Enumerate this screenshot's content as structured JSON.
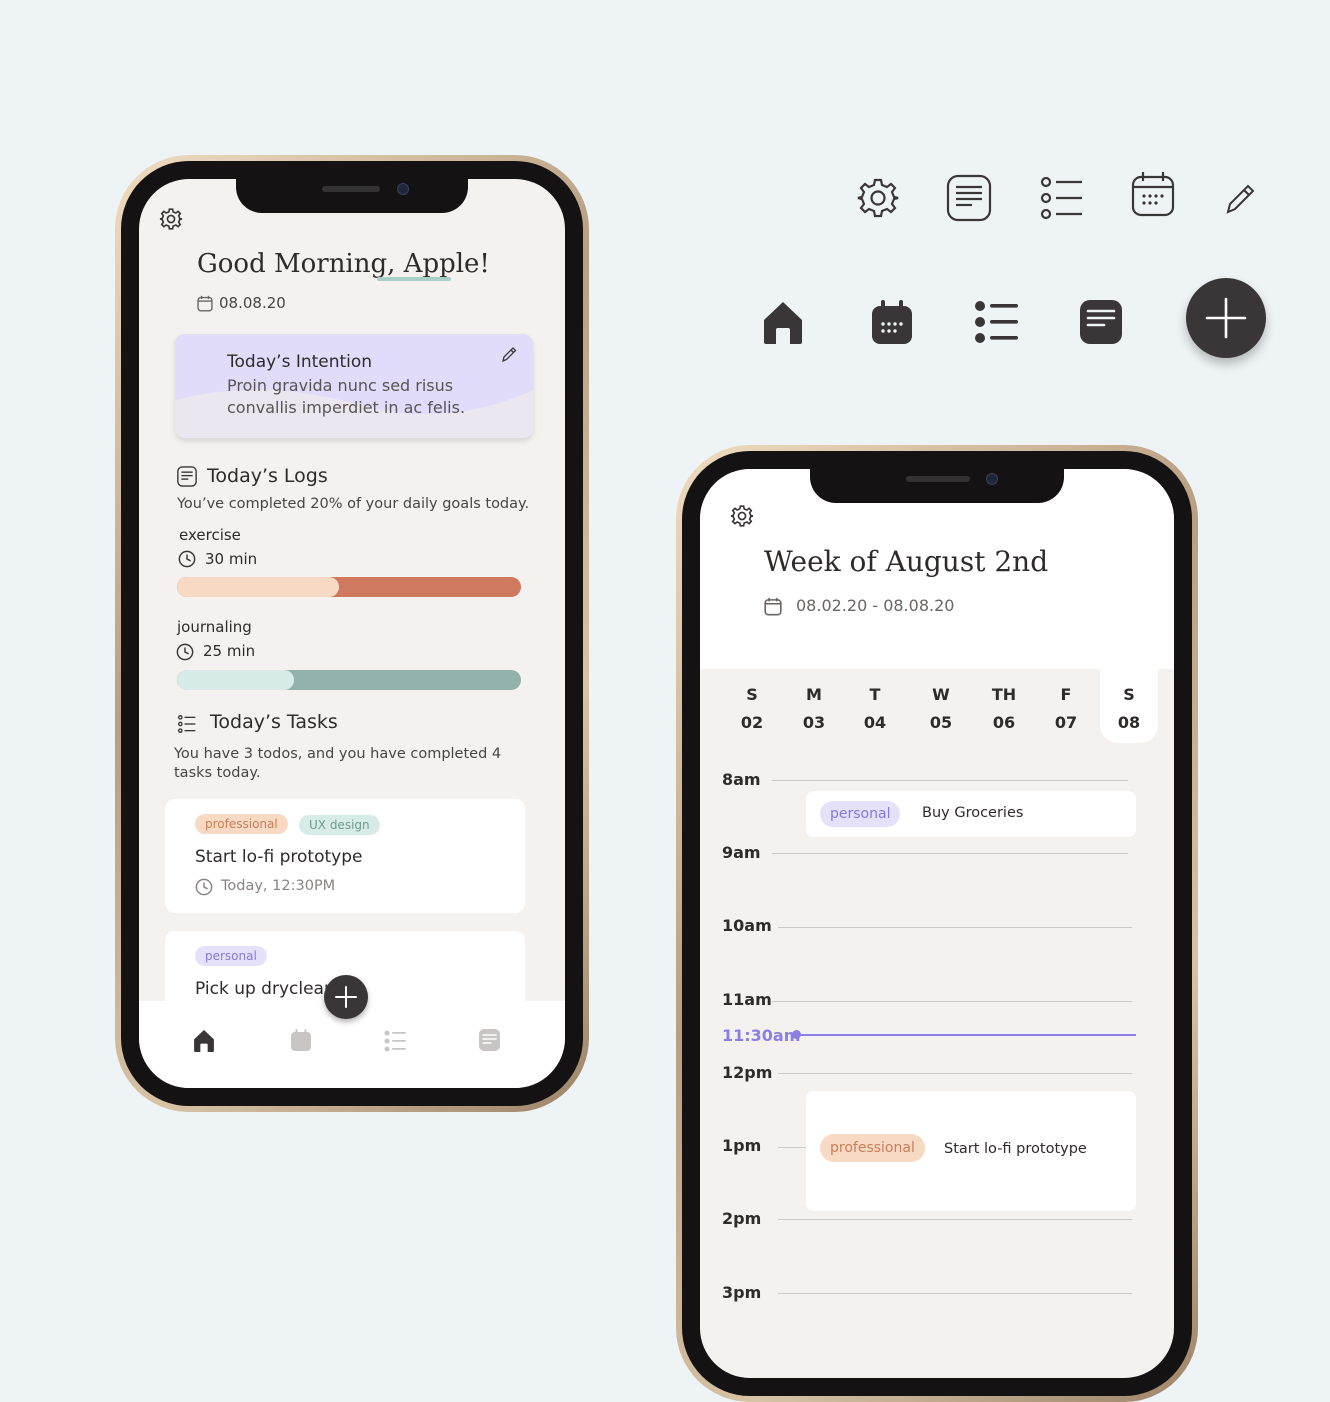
{
  "home": {
    "greeting": "Good Morning, Apple!",
    "date": "08.08.20",
    "intention": {
      "title": "Today’s Intention",
      "text": "Proin gravida nunc sed risus convallis imperdiet in ac felis."
    },
    "logs": {
      "title": "Today’s Logs",
      "subtitle": "You’ve completed 20% of your daily goals today.",
      "items": [
        {
          "name": "exercise",
          "duration": "30 min",
          "progress": 0.47
        },
        {
          "name": "journaling",
          "duration": "25 min",
          "progress": 0.34
        }
      ]
    },
    "tasks": {
      "title": "Today’s Tasks",
      "subtitle": "You have 3 todos, and you have completed 4 tasks today.",
      "items": [
        {
          "tags": [
            "professional",
            "UX design"
          ],
          "title": "Start lo-fi prototype",
          "time": "Today, 12:30PM"
        },
        {
          "tags": [
            "personal"
          ],
          "title": "Pick up dryclean"
        }
      ]
    }
  },
  "week": {
    "title": "Week of August 2nd",
    "range": "08.02.20 - 08.08.20",
    "days": [
      {
        "letter": "S",
        "date": "02"
      },
      {
        "letter": "M",
        "date": "03"
      },
      {
        "letter": "T",
        "date": "04"
      },
      {
        "letter": "W",
        "date": "05"
      },
      {
        "letter": "TH",
        "date": "06"
      },
      {
        "letter": "F",
        "date": "07"
      },
      {
        "letter": "S",
        "date": "08"
      }
    ],
    "hours": [
      "8am",
      "9am",
      "10am",
      "11am",
      "12pm",
      "1pm",
      "2pm",
      "3pm"
    ],
    "now": "11:30am",
    "events": [
      {
        "tag": "personal",
        "title": "Buy Groceries"
      },
      {
        "tag": "professional",
        "title": "Start lo-fi prototype"
      }
    ]
  },
  "icon_set": {
    "outline": [
      "gear-icon",
      "notes-icon",
      "list-icon",
      "calendar-icon",
      "pencil-icon"
    ],
    "filled": [
      "home-icon",
      "calendar-icon",
      "list-icon",
      "notes-icon",
      "plus-icon"
    ]
  },
  "colors": {
    "background": "#eef4f6",
    "screen": "#f5f1ef",
    "dark": "#3a3536",
    "intention": "#e0dcfa",
    "exercise_light": "#f7d9c4",
    "exercise_dark": "#cf7a5e",
    "journaling_light": "#d7ece8",
    "journaling_dark": "#93b2ad",
    "now_line": "#8b7fe6"
  }
}
